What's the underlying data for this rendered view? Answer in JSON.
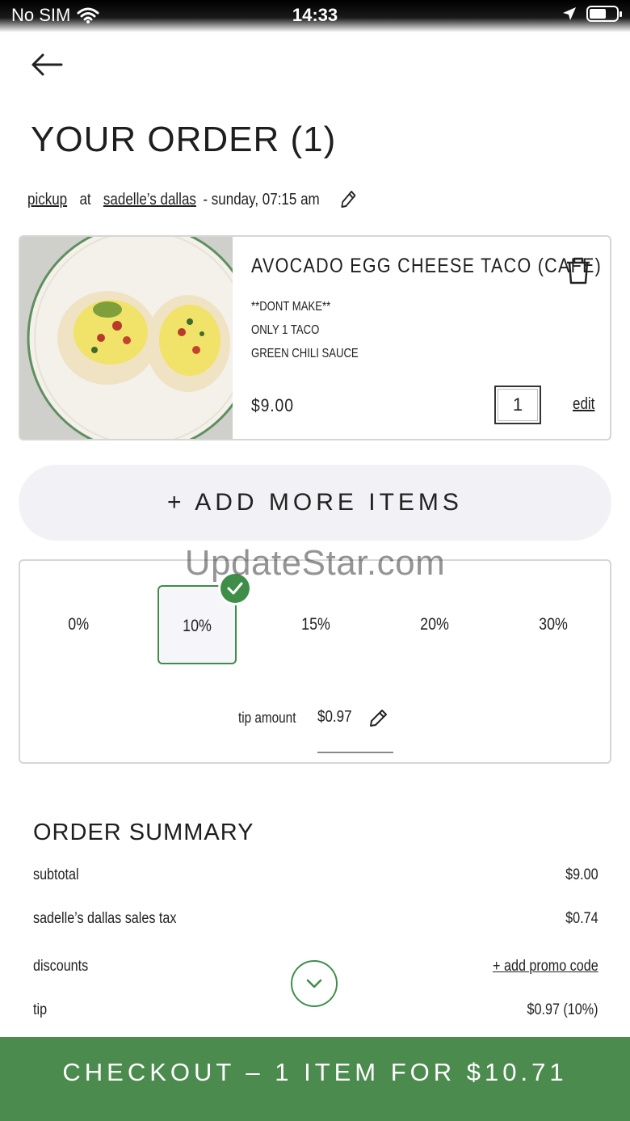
{
  "status_bar": {
    "carrier": "No SIM",
    "time": "14:33"
  },
  "page": {
    "title": "YOUR ORDER (1)"
  },
  "pickup": {
    "mode": "pickup",
    "at": "at",
    "location": "sadelle’s dallas",
    "when": "- sunday, 07:15 am"
  },
  "item": {
    "name": "AVOCADO EGG CHEESE TACO (CAFE)",
    "modifiers": [
      "**DONT MAKE**",
      "ONLY 1 TACO",
      "GREEN CHILI SAUCE"
    ],
    "price": "$9.00",
    "quantity": "1",
    "edit_label": "edit"
  },
  "add_more": {
    "label": "+ ADD MORE ITEMS"
  },
  "watermark": "UpdateStar.com",
  "tip": {
    "options": [
      "0%",
      "10%",
      "15%",
      "20%",
      "30%"
    ],
    "selected": "10%",
    "amount_label": "tip amount",
    "amount": "$0.97"
  },
  "summary": {
    "title": "ORDER SUMMARY",
    "subtotal_label": "subtotal",
    "subtotal": "$9.00",
    "tax_label": "sadelle’s dallas sales tax",
    "tax": "$0.74",
    "discounts_label": "discounts",
    "promo_label": "+ add promo code",
    "tip_label": "tip",
    "tip": "$0.97 (10%)"
  },
  "checkout": {
    "label": "CHECKOUT – 1 ITEM FOR $10.71"
  },
  "colors": {
    "accent_green": "#4b8b4e",
    "check_green": "#3e8e4a"
  }
}
